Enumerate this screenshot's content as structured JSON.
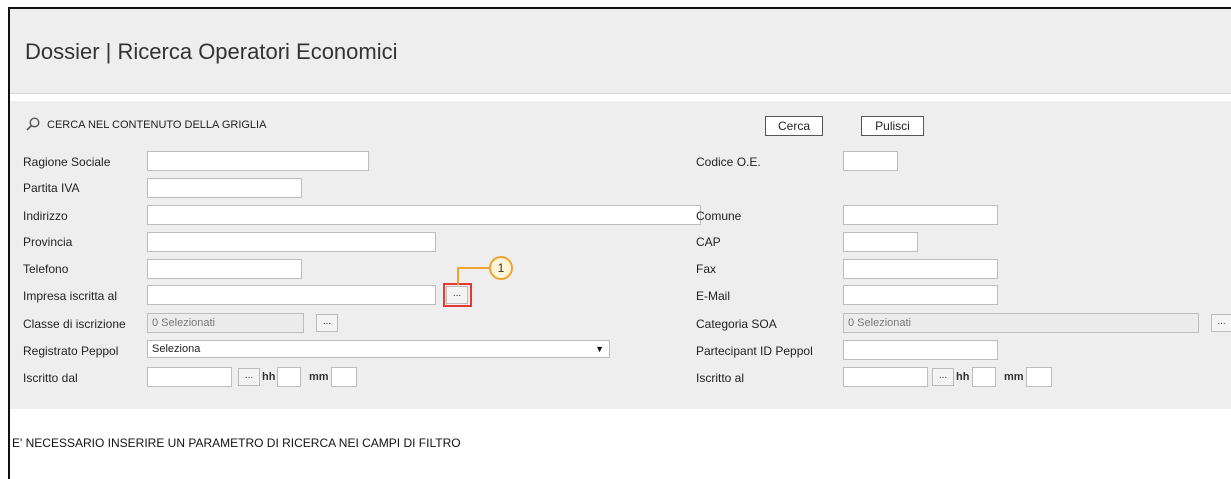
{
  "page_title": "Dossier | Ricerca Operatori Economici",
  "search_section": {
    "heading": "CERCA NEL CONTENUTO DELLA GRIGLIA",
    "search_button": "Cerca",
    "clear_button": "Pulisci"
  },
  "fields": {
    "ragione_sociale": {
      "label": "Ragione Sociale",
      "value": ""
    },
    "partita_iva": {
      "label": "Partita IVA",
      "value": ""
    },
    "indirizzo": {
      "label": "Indirizzo",
      "value": ""
    },
    "provincia": {
      "label": "Provincia",
      "value": ""
    },
    "telefono": {
      "label": "Telefono",
      "value": ""
    },
    "impresa_iscritta_al": {
      "label": "Impresa iscritta al",
      "value": "",
      "lookup": "..."
    },
    "classe_iscrizione": {
      "label": "Classe di iscrizione",
      "value": "0 Selezionati",
      "lookup": "..."
    },
    "registrato_peppol": {
      "label": "Registrato Peppol",
      "value": "Seleziona",
      "arrow": "▼"
    },
    "iscritto_dal": {
      "label": "Iscritto dal",
      "date_value": "",
      "lookup": "...",
      "hh_label": "hh",
      "hh_value": "",
      "mm_label": "mm",
      "mm_value": ""
    },
    "codice_oe": {
      "label": "Codice O.E.",
      "value": ""
    },
    "comune": {
      "label": "Comune",
      "value": ""
    },
    "cap": {
      "label": "CAP",
      "value": ""
    },
    "fax": {
      "label": "Fax",
      "value": ""
    },
    "email": {
      "label": "E-Mail",
      "value": ""
    },
    "categoria_soa": {
      "label": "Categoria SOA",
      "value": "0 Selezionati",
      "lookup": "..."
    },
    "partecipant_id_peppol": {
      "label": "Partecipant ID Peppol",
      "value": ""
    },
    "iscritto_al": {
      "label": "Iscritto al",
      "date_value": "",
      "lookup": "...",
      "hh_label": "hh",
      "hh_value": "",
      "mm_label": "mm",
      "mm_value": ""
    }
  },
  "callout": {
    "number": "1",
    "color": "#f0a233",
    "highlight_color": "#e53935"
  },
  "notice": "E' NECESSARIO INSERIRE UN PARAMETRO DI RICERCA NEI CAMPI DI FILTRO"
}
